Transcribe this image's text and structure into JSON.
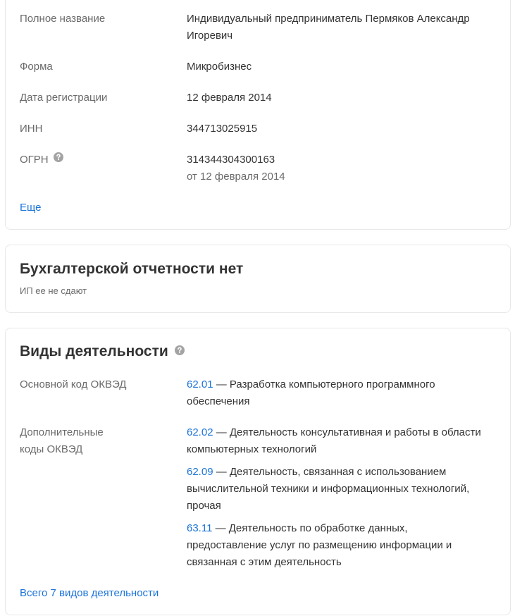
{
  "details": {
    "full_name_label": "Полное название",
    "full_name_value": "Индивидуальный предприниматель Пермяков Александр Игоревич",
    "form_label": "Форма",
    "form_value": "Микробизнес",
    "reg_date_label": "Дата регистрации",
    "reg_date_value": "12 февраля 2014",
    "inn_label": "ИНН",
    "inn_value": "344713025915",
    "ogrn_label": "ОГРН",
    "ogrn_value": "314344304300163",
    "ogrn_date": "от 12 февраля 2014",
    "more_link": "Еще"
  },
  "accounting": {
    "title": "Бухгалтерской отчетности нет",
    "note": "ИП ее не сдают"
  },
  "activities": {
    "title": "Виды деятельности",
    "main_label": "Основной код ОКВЭД",
    "main": {
      "code": "62.01",
      "text": " — Разработка компьютерного программного обеспечения"
    },
    "additional_label": "Дополнительные коды ОКВЭД",
    "additional": [
      {
        "code": "62.02",
        "text": " — Деятельность консультативная и работы в области компьютерных технологий"
      },
      {
        "code": "62.09",
        "text": " — Деятельность, связанная с использованием вычислительной техники и информационных технологий, прочая"
      },
      {
        "code": "63.11",
        "text": " — Деятельность по обработке данных, предоставление услуг по размещению информации и связанная с этим деятельность"
      }
    ],
    "all_link": "Всего 7 видов деятельности"
  },
  "icons": {
    "help": "question-circle-icon"
  },
  "colors": {
    "link": "#1a73d9",
    "label": "#6a6a6a",
    "text": "#333333",
    "border": "#e8e8e8",
    "icon": "#a3a3a3"
  }
}
